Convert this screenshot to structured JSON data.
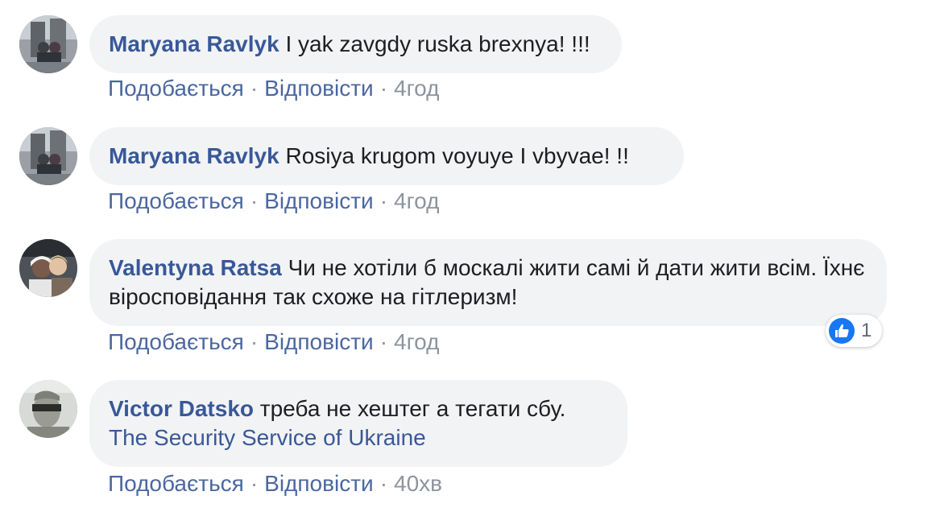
{
  "comments": [
    {
      "author": "Maryana Ravlyk",
      "text": "I yak zavgdy ruska brexnya! !!!",
      "link": "",
      "actions": {
        "like": "Подобається",
        "reply": "Відповісти",
        "time": "4год"
      }
    },
    {
      "author": "Maryana Ravlyk",
      "text": "Rosiya krugom voyuye I vbyvae! !!",
      "link": "",
      "actions": {
        "like": "Подобається",
        "reply": "Відповісти",
        "time": "4год"
      }
    },
    {
      "author": "Valentyna Ratsa",
      "text": "Чи не хотіли б москалі жити самі й дати жити всім. Їхнє віросповідання так схоже на гітлеризм!",
      "link": "",
      "reaction_count": "1",
      "actions": {
        "like": "Подобається",
        "reply": "Відповісти",
        "time": "4год"
      }
    },
    {
      "author": "Victor Datsko",
      "text": "треба не хештег а тегати сбу.",
      "link": "The Security Service of Ukraine",
      "actions": {
        "like": "Подобається",
        "reply": "Відповісти",
        "time": "40хв"
      }
    }
  ],
  "separator": "·",
  "colors": {
    "author": "#385898",
    "bubble_bg": "#f2f3f5",
    "action_link": "#4b67a1",
    "meta": "#8d949e",
    "like_blue": "#1877f2"
  },
  "icons": {
    "reaction": "thumbs-up-icon"
  }
}
